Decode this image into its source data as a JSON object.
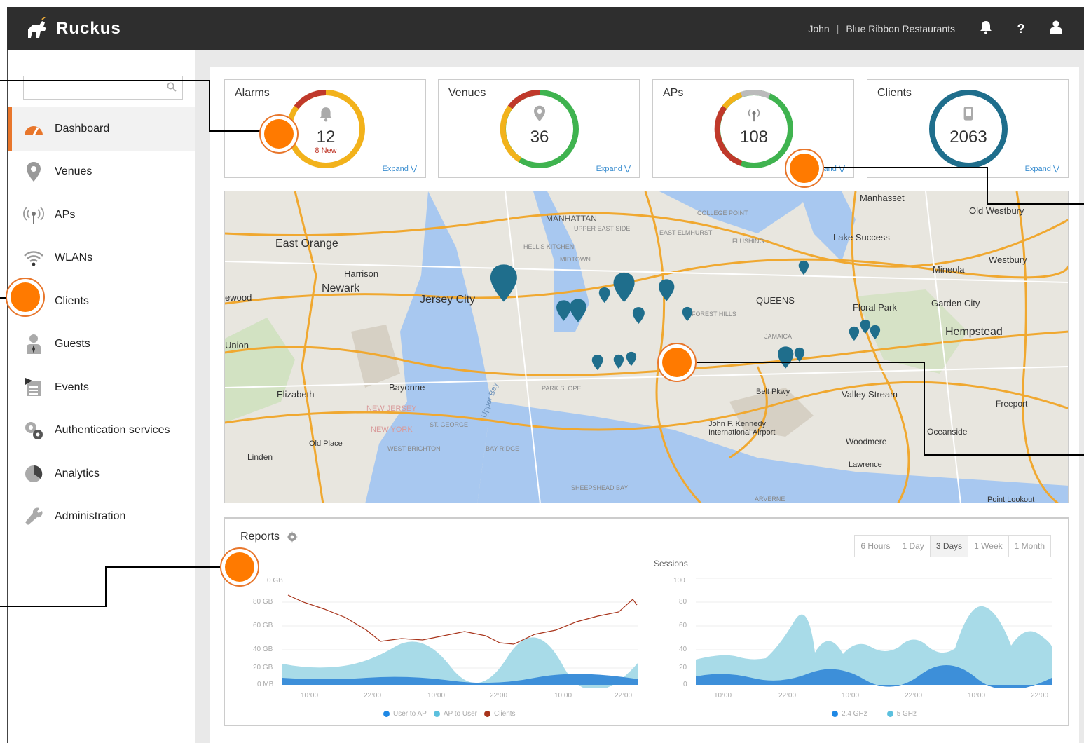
{
  "header": {
    "brand": "Ruckus",
    "user": "John",
    "separator": "|",
    "org": "Blue Ribbon Restaurants",
    "icons": [
      "bell-icon",
      "help-icon",
      "user-icon"
    ]
  },
  "search": {
    "placeholder": ""
  },
  "sidebar": {
    "items": [
      {
        "label": "Dashboard",
        "icon": "dashboard-icon"
      },
      {
        "label": "Venues",
        "icon": "location-pin-icon"
      },
      {
        "label": "APs",
        "icon": "access-point-icon"
      },
      {
        "label": "WLANs",
        "icon": "wifi-icon"
      },
      {
        "label": "Clients",
        "icon": "client-icon"
      },
      {
        "label": "Guests",
        "icon": "guest-icon"
      },
      {
        "label": "Events",
        "icon": "events-icon"
      },
      {
        "label": "Authentication services",
        "icon": "gears-icon"
      },
      {
        "label": "Analytics",
        "icon": "pie-chart-icon"
      },
      {
        "label": "Administration",
        "icon": "wrench-icon"
      }
    ]
  },
  "cards": [
    {
      "title": "Alarms",
      "value": "12",
      "sub": "8 New",
      "expand": "Expand"
    },
    {
      "title": "Venues",
      "value": "36",
      "sub": "",
      "expand": "Expand"
    },
    {
      "title": "APs",
      "value": "108",
      "sub": "",
      "expand": "Expand"
    },
    {
      "title": "Clients",
      "value": "2063",
      "sub": "",
      "expand": "Expand"
    }
  ],
  "map": {
    "labels": [
      "Manhasset",
      "Old Westbury",
      "MANHATTAN",
      "UPPER EAST SIDE",
      "COLLEGE POINT",
      "EAST ELMHURST",
      "FLUSHING",
      "Lake Success",
      "East Orange",
      "HELL'S KITCHEN",
      "MIDTOWN",
      "Westbury",
      "Harrison",
      "Mineola",
      "Newark",
      "Jersey City",
      "QUEENS",
      "Floral Park",
      "Garden City",
      "FOREST HILLS",
      "JAMAICA",
      "Hempstead",
      "Union",
      "Bayonne",
      "Elizabeth",
      "Valley Stream",
      "Freeport",
      "John F. Kennedy International Airport",
      "Oceanside",
      "Old Place",
      "Woodmere",
      "Linden",
      "Lawrence",
      "Point Lookout",
      "PARK SLOPE",
      "BAY RIDGE",
      "WEST BRIGHTON",
      "ST. GEORGE",
      "NEW JERSEY",
      "NEW YORK",
      "SHEEPSHEAD BAY",
      "ARVERNE",
      "Upper Bay",
      "Belt Pkwy",
      "ewood"
    ]
  },
  "reports": {
    "title": "Reports",
    "ranges": [
      "6 Hours",
      "1 Day",
      "3 Days",
      "1 Week",
      "1 Month"
    ],
    "selected_range": "3 Days",
    "traffic_yticks": [
      "0 GB",
      "80 GB",
      "60 GB",
      "40 GB",
      "20 GB",
      "0 MB"
    ],
    "sessions_label": "Sessions",
    "sessions_yticks": [
      "100",
      "80",
      "60",
      "40",
      "20",
      "0"
    ],
    "xticks": [
      "10:00",
      "22:00",
      "10:00",
      "22:00",
      "10:00",
      "22:00"
    ],
    "legend_left": [
      {
        "label": "User to AP",
        "color": "#1e88e5"
      },
      {
        "label": "AP to User",
        "color": "#5bc0de"
      },
      {
        "label": "Clients",
        "color": "#a8341b"
      }
    ],
    "legend_right": [
      {
        "label": "2.4 GHz",
        "color": "#1e88e5"
      },
      {
        "label": "5 GHz",
        "color": "#5bc0de"
      }
    ]
  },
  "colors": {
    "accent": "#e8762b",
    "pin": "#1f6e8c",
    "callout": "#ff7a00"
  }
}
